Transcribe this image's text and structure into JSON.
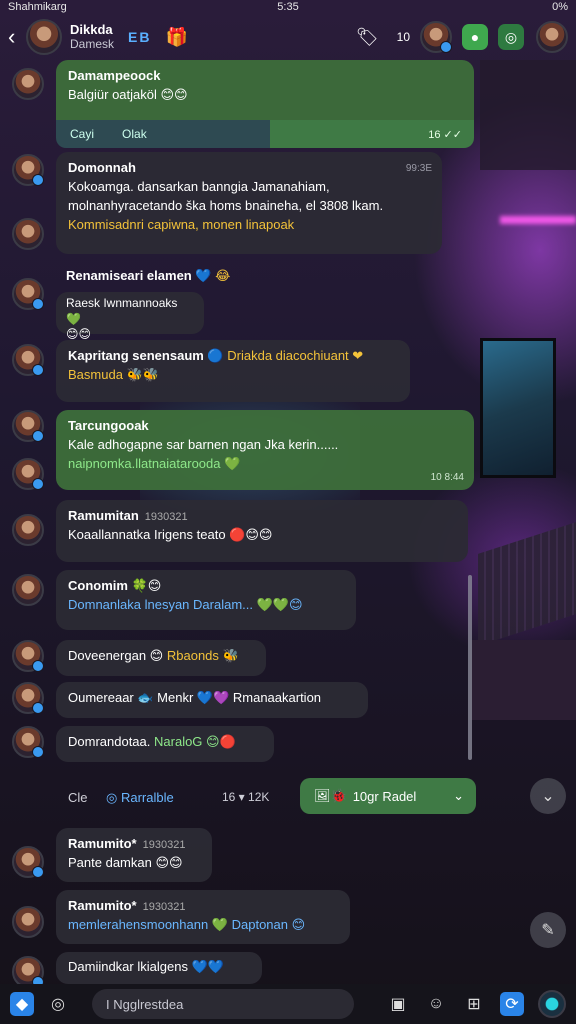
{
  "status": {
    "carrier": "Shahmikarg",
    "time": "5:35",
    "right": "0%"
  },
  "header": {
    "title": "Dikkda",
    "subtitle": "Damesk",
    "emblems": "EB",
    "count": "10",
    "back_icon": "chevron-left-icon"
  },
  "messages": [
    {
      "name": "Damampeoock",
      "lines": [
        "Balgiür oatjaköl 😊😊"
      ],
      "reply": {
        "left_a": "Cayi",
        "left_b": "Olak",
        "right": "16 ✓✓"
      }
    },
    {
      "name": "Domonnah",
      "time": "99:3E",
      "lines": [
        "Kokoamga. dansarkan banngia Jamanahiam,",
        "molnanhyracetando ška homs bnaineha, el 3808 lkam."
      ],
      "accent": "Kommisadnri capiwna, monen linapoak"
    },
    {
      "name": "Renamiseari elamen 💙",
      "suffix": "😂",
      "lines": [
        "Raesk Iwnmannoaks 💚",
        "😊😊"
      ]
    },
    {
      "name": "Kapritang senensaum 🔵",
      "name_accent": "Driakda diacochiuant ❤",
      "accent": "Basmuda 🐝🐝"
    },
    {
      "name": "Tarcungooak",
      "lines": [
        "Kale adhogapne sar barnen ngan Jka kerin......"
      ],
      "accent": "naipnomka.llatnaiatarooda 💚",
      "time": "10 8:44"
    },
    {
      "name": "Ramumitan",
      "meta": "1930321",
      "lines": [
        "Koaallannatka Irigens teato 🔴😊😊"
      ]
    },
    {
      "name": "Conomim 🍀😊",
      "lines": [
        "Domnanlaka lnesyan Daralam... 💚💚😊"
      ]
    },
    {
      "name": "Doveenergan 😊",
      "name_accent": "Rbaonds 🐝"
    },
    {
      "name": "Oumereaar 🐟 Menkr 💙💜 Rmanaakartion"
    },
    {
      "name": "Domrandotaa.",
      "name_accent": "NaraloG 😊🔴"
    },
    {
      "name": "Ramumito*",
      "meta": "1930321",
      "lines": [
        "Pante damkan 😊😊"
      ]
    },
    {
      "name": "Ramumito*",
      "meta": "1930321",
      "lines": [
        "memlerahensmoonhann 💚 Daptonan 😊"
      ]
    },
    {
      "name": "Damiindkar lkialgens 💙💙"
    }
  ],
  "system_row": {
    "left": "Cle",
    "link": "◎ Rarralble",
    "num": "16  ▾  12K",
    "pill": "10gr Radel",
    "pill_icons": "🖼🐞"
  },
  "input": {
    "placeholder": "I Ngglrestdea"
  },
  "icons": {
    "tools": [
      "shield-icon",
      "circle-icon"
    ],
    "right": [
      "camera-icon",
      "sticker-icon",
      "grid-icon",
      "refresh-icon",
      "avatar-icon"
    ]
  }
}
